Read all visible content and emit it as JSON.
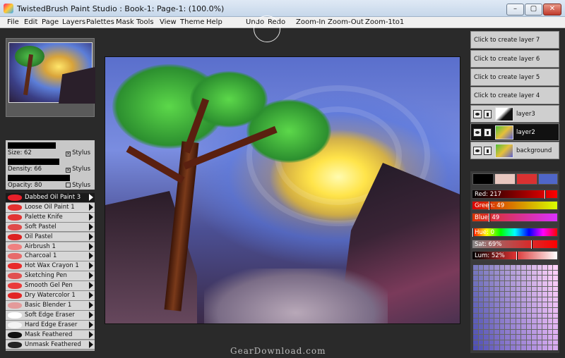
{
  "window": {
    "title": "TwistedBrush Paint Studio : Book-1: Page-1:  (100.0%)",
    "min_glyph": "–",
    "max_glyph": "▢",
    "close_glyph": "✕"
  },
  "menu": {
    "items": [
      "File",
      "Edit",
      "Page",
      "Layers",
      "Palettes",
      "Mask",
      "Tools",
      "View",
      "Theme",
      "Help"
    ],
    "actions": [
      "Undo",
      "Redo",
      "Zoom-In",
      "Zoom-Out",
      "Zoom-1to1"
    ]
  },
  "brush_settings": {
    "size": {
      "label": "Size: 62",
      "stylus": "Stylus",
      "stylus_checked": true,
      "level": 0.62
    },
    "density": {
      "label": "Density: 66",
      "stylus": "Stylus",
      "stylus_checked": true,
      "level": 0.66
    },
    "opacity": {
      "label": "Opacity: 80",
      "stylus": "Stylus",
      "stylus_checked": false,
      "level": 0.8
    }
  },
  "brushes": [
    {
      "label": "Dabbed Oil Paint 3",
      "selected": true,
      "swatch": "#e8202a"
    },
    {
      "label": "Loose Oil Paint 1",
      "selected": false,
      "swatch": "#e33030"
    },
    {
      "label": "Palette Knife",
      "selected": false,
      "swatch": "#e23434"
    },
    {
      "label": "Soft Pastel",
      "selected": false,
      "swatch": "#e04a4a"
    },
    {
      "label": "Oil Pastel",
      "selected": false,
      "swatch": "#dd2222"
    },
    {
      "label": "Airbrush 1",
      "selected": false,
      "swatch": "#f08080"
    },
    {
      "label": "Charcoal 1",
      "selected": false,
      "swatch": "#e86a6a"
    },
    {
      "label": "Hot Wax Crayon 1",
      "selected": false,
      "swatch": "#e82a2a"
    },
    {
      "label": "Sketching Pen",
      "selected": false,
      "swatch": "#e15050"
    },
    {
      "label": "Smooth Gel Pen",
      "selected": false,
      "swatch": "#ea3a3a"
    },
    {
      "label": "Dry Watercolor 1",
      "selected": false,
      "swatch": "#e22525"
    },
    {
      "label": "Basic Blender 1",
      "selected": false,
      "swatch": "#e49a9a"
    },
    {
      "label": "Soft Edge Eraser",
      "selected": false,
      "swatch": "#ffffff"
    },
    {
      "label": "Hard Edge Eraser",
      "selected": false,
      "swatch": "#f4f4f4"
    },
    {
      "label": "Mask Feathered",
      "selected": false,
      "swatch": "#111111"
    },
    {
      "label": "Unmask Feathered",
      "selected": false,
      "swatch": "#222222"
    }
  ],
  "layers": [
    {
      "label": "Click to create layer 7",
      "type": "empty"
    },
    {
      "label": "Click to create layer 6",
      "type": "empty"
    },
    {
      "label": "Click to create layer 5",
      "type": "empty"
    },
    {
      "label": "Click to create layer 4",
      "type": "empty"
    },
    {
      "label": "layer3",
      "type": "image",
      "selected": false
    },
    {
      "label": "layer2",
      "type": "image",
      "selected": true
    },
    {
      "label": "background",
      "type": "image",
      "selected": false
    }
  ],
  "colors": {
    "chips": [
      "#000000",
      "#e8c8c0",
      "#d93131",
      "#4f66c8"
    ],
    "red": {
      "label": "Red: 217",
      "value": 217
    },
    "green": {
      "label": "Green: 49",
      "value": 49
    },
    "blue": {
      "label": "Blue: 49",
      "value": 49
    },
    "hue": {
      "label": "Hue: 0",
      "value": 0
    },
    "sat": {
      "label": "Sat: 69%",
      "value": 69
    },
    "lum": {
      "label": "Lum: 52%",
      "value": 52
    }
  },
  "footer": {
    "watermark": "GearDownload.com"
  }
}
